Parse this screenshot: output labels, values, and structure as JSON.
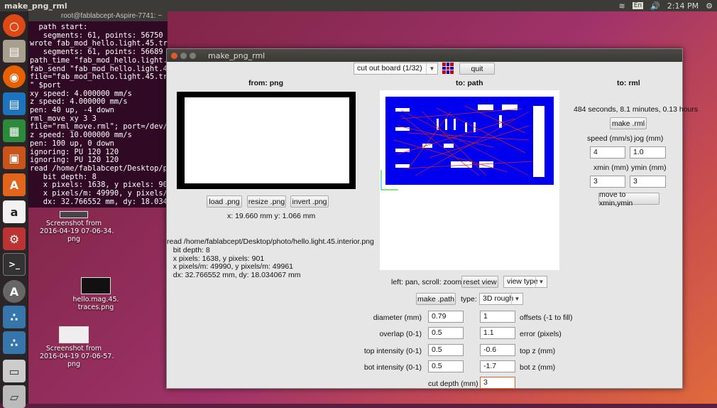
{
  "topbar": {
    "app_title": "make_png_rml",
    "keyboard": "En",
    "clock": "2:14 PM"
  },
  "terminal": {
    "title": "root@fablabcept-Aspire-7741: ~",
    "lines": [
      "  path start:",
      "   segments: 61, points: 56750",
      "wrote fab_mod_hello.light.45.traces.rml",
      "   segments: 61, points: 56689",
      "path_time \"fab_mod_hello.light.45.",
      "fab_send \"fab_mod_hello.light.45.t",
      "file=\"fab_mod_hello.light.45.traces",
      "\" $port",
      "xy speed: 4.000000 mm/s",
      "z speed: 4.000000 mm/s",
      "pen: 40 up, -4 down",
      "rml_move xy 3 3",
      "file=\"rml_move.rml\"; port=/dev/t",
      "z speed: 10.000000 mm/s",
      "pen: 100 up, 0 down",
      "ignoring: PU 120 120",
      "ignoring: PU 120 120",
      "read /home/fablabcept/Desktop/photo",
      "   bit depth: 8",
      "   x pixels: 1638, y pixels: 901",
      "   x pixels/m: 49990, y pixels/m:",
      "   dx: 32.766552 mm, dy: 18.034067"
    ]
  },
  "desktop_icons": [
    {
      "label": "Screenshot from\n2016-04-19 07-06-34.\npng"
    },
    {
      "label": "hello.mag.45.\ntraces.png"
    },
    {
      "label": "Screenshot from\n2016-04-19 07-06-57.\npng"
    }
  ],
  "window": {
    "title": "make_png_rml",
    "process_select": "cut out board (1/32)",
    "quit_label": "quit",
    "from_header": "from: png",
    "path_header": "to: path",
    "rml_header": "to: rml",
    "load_label": "load .png",
    "resize_label": "resize .png",
    "invert_label": "invert .png",
    "coords": "x: 19.660 mm  y: 1.066 mm",
    "read_log": "read /home/fablabcept/Desktop/photo/hello.light.45.interior.png\n   bit depth: 8\n   x pixels: 1638, y pixels: 901\n   x pixels/m: 49990, y pixels/m: 49961\n   dx: 32.766552 mm, dy: 18.034067 mm",
    "view_hint": "left: pan, scroll: zoom",
    "reset_view_label": "reset view",
    "view_type": "view type",
    "make_path_label": "make .path",
    "type_label": "type:",
    "type_value": "3D rough",
    "time_estimate": "484 seconds, 8.1 minutes, 0.13 hours",
    "make_rml_label": "make .rml",
    "speed_label": "speed (mm/s)",
    "jog_label": "jog (mm)",
    "speed_value": "4",
    "jog_value": "1.0",
    "xmin_label": "xmin (mm)",
    "ymin_label": "ymin (mm)",
    "xmin_value": "3",
    "ymin_value": "3",
    "move_label": "move to xmin,ymin",
    "params": [
      {
        "left_label": "diameter (mm)",
        "left_value": "0.79",
        "right_value": "1",
        "right_label": "offsets (-1 to fill)"
      },
      {
        "left_label": "overlap (0-1)",
        "left_value": "0.5",
        "right_value": "1.1",
        "right_label": "error (pixels)"
      },
      {
        "left_label": "top intensity (0-1)",
        "left_value": "0.5",
        "right_value": "-0.6",
        "right_label": "top z (mm)"
      },
      {
        "left_label": "bot intensity (0-1)",
        "left_value": "0.5",
        "right_value": "-1.7",
        "right_label": "bot z (mm)"
      }
    ],
    "cut_depth_label": "cut depth (mm)",
    "cut_depth_value": "3"
  }
}
